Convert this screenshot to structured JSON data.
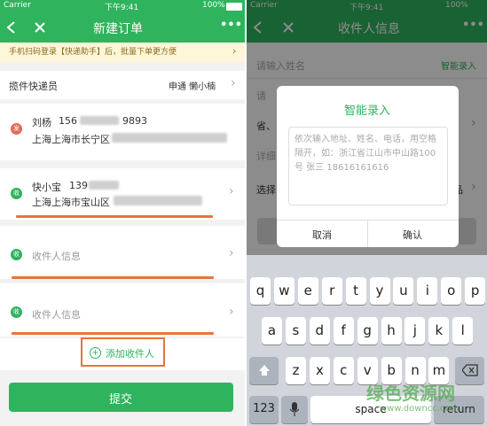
{
  "left": {
    "status": {
      "carrier": "Carrier",
      "time": "下午9:41",
      "battery": "100%"
    },
    "nav": {
      "back_icon": "back-chevron",
      "close_icon": "close-x",
      "title": "新建订单",
      "more": "•••"
    },
    "banner": "手机扫码登录【快递助手】后，批量下单更方便",
    "courier": {
      "label": "揽件快递员",
      "value": "申通   懒小楠"
    },
    "sender": {
      "badge": "发",
      "name": "刘杨",
      "phone_prefix": "156",
      "phone_suffix": "9893",
      "address": "上海上海市长宁区"
    },
    "recipients": [
      {
        "badge": "收",
        "name": "快小宝",
        "phone_prefix": "139",
        "address": "上海上海市宝山区"
      },
      {
        "badge": "收",
        "placeholder": "收件人信息"
      },
      {
        "badge": "收",
        "placeholder": "收件人信息"
      }
    ],
    "add_recipient": "添加收件人",
    "submit": "提交"
  },
  "right": {
    "status": {
      "carrier": "Carrier",
      "time": "下午9:41",
      "battery": "100%"
    },
    "nav": {
      "title": "收件人信息",
      "more": "•••"
    },
    "form": {
      "name_placeholder": "请输入姓名",
      "smart_entry": "智能录入",
      "row2": "请",
      "row3": "省、",
      "row4": "详细",
      "row5": "选择",
      "row5_right": "品"
    },
    "dialog": {
      "title": "智能录入",
      "placeholder": "依次输入地址、姓名、电话，用空格隔开，如：浙江省江山市中山路100号 张三 18616161616",
      "cancel": "取消",
      "confirm": "确认"
    },
    "keyboard": {
      "row1": [
        "q",
        "w",
        "e",
        "r",
        "t",
        "y",
        "u",
        "i",
        "o",
        "p"
      ],
      "row2": [
        "a",
        "s",
        "d",
        "f",
        "g",
        "h",
        "j",
        "k",
        "l"
      ],
      "row3": [
        "z",
        "x",
        "c",
        "v",
        "b",
        "n",
        "m"
      ],
      "numbers": "123",
      "space": "space",
      "return": "return"
    },
    "watermark": {
      "brand": "绿色资源网",
      "url": "www.downcc.com"
    }
  },
  "colors": {
    "brand_green": "#2fb35d",
    "highlight_orange": "#e8743c",
    "sender_red": "#e06c5a"
  }
}
